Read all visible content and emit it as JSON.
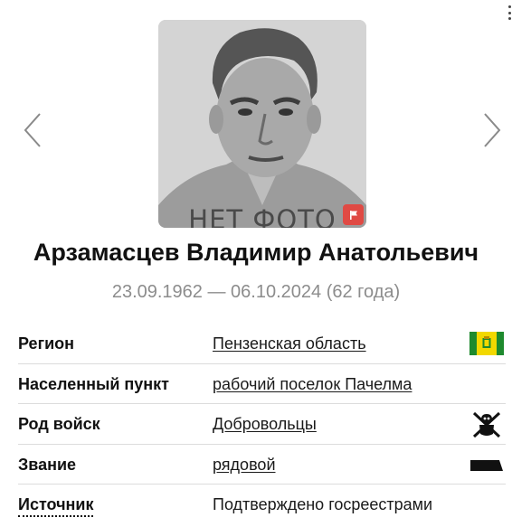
{
  "photo": {
    "placeholder_text": "НЕТ ФОТО"
  },
  "person": {
    "name": "Арзамасцев Владимир Анатольевич",
    "dates": "23.09.1962 — 06.10.2024 (62 года)"
  },
  "details": [
    {
      "label": "Регион",
      "value": "Пензенская область",
      "link": true,
      "icon": "region-flag-icon"
    },
    {
      "label": "Населенный пункт",
      "value": "рабочий поселок Пачелма",
      "link": true,
      "icon": null
    },
    {
      "label": "Род войск",
      "value": "Добровольцы",
      "link": true,
      "icon": "volunteers-emblem-icon"
    },
    {
      "label": "Звание",
      "value": "рядовой",
      "link": true,
      "icon": "rank-insignia-icon"
    },
    {
      "label": "Источник",
      "value": "Подтверждено госреестрами",
      "link": false,
      "icon": null
    }
  ],
  "colors": {
    "report_button": "#e04a44",
    "dates_text": "#8c8c8c",
    "region_flag_green": "#1e8a2e",
    "region_flag_yellow": "#f2d800"
  }
}
